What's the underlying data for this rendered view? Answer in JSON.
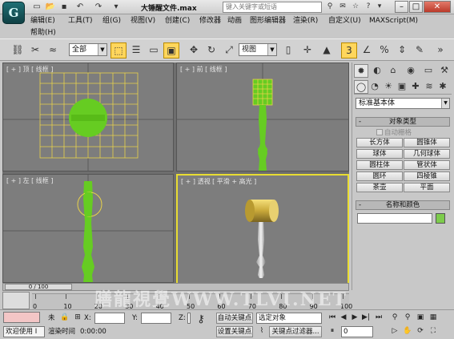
{
  "titlebar": {
    "logo_letter": "G",
    "title": "大锤醒文件.max",
    "search_placeholder": "键入关键字或短语",
    "window_buttons": {
      "minimize": "–",
      "restore": "□",
      "close": "✕"
    }
  },
  "menu": {
    "items": [
      "编辑(E)",
      "工具(T)",
      "组(G)",
      "视图(V)",
      "创建(C)",
      "修改器",
      "动画",
      "图形编辑器",
      "渲染(R)",
      "自定义(U)",
      "MAXScript(M)"
    ],
    "help": "帮助(H)"
  },
  "toolbar": {
    "selection_filter": "全部",
    "ref_coord": "视图"
  },
  "viewports": {
    "top": "[ + ] 顶 [ 线框 ]",
    "front": "[ + ] 前 [ 线框 ]",
    "left": "[ + ] 左 [ 线框 ]",
    "perspective": "[ + ] 透视 [ 平滑 + 高光 ]"
  },
  "command_panel": {
    "category": "标准基本体",
    "object_type_title": "对象类型",
    "autogrid": "自动栅格",
    "buttons": [
      "长方体",
      "圆锥体",
      "球体",
      "几何球体",
      "圆柱体",
      "管状体",
      "圆环",
      "四棱锥",
      "茶壶",
      "平面"
    ],
    "name_color_title": "名称和颜色",
    "minus": "-",
    "colors": {
      "swatch": "#7dcc4c"
    }
  },
  "timeline": {
    "thumb": "0 / 100",
    "ticks": [
      "0",
      "10",
      "20",
      "30",
      "40",
      "50",
      "60",
      "70",
      "80",
      "90",
      "100"
    ]
  },
  "statusbar": {
    "selection": "未",
    "welcome": "欢迎使用 I",
    "x_label": "X:",
    "y_label": "Y:",
    "z_label": "Z:",
    "render_time_label": "渲染时间",
    "render_time": "0:00:00",
    "auto_key": "自动关键点",
    "set_key": "设置关键点",
    "key_mode_value": "选定对象",
    "key_filters": "关键点过滤器...",
    "frame": "0"
  },
  "watermark": "膳龍視覺WWW.TLVI.NET"
}
